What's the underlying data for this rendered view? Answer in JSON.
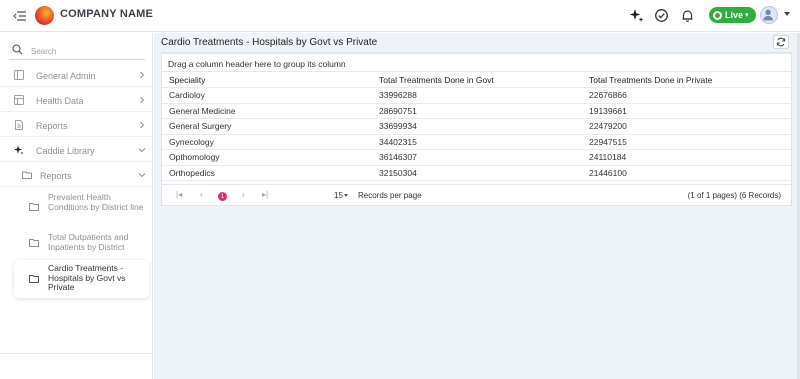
{
  "header": {
    "company_name": "COMPANY NAME",
    "live_label": "Live",
    "colors": {
      "live": "#2fae3b",
      "brand_primary": "#f2591f"
    },
    "icons": [
      "menu-collapse-icon",
      "sparkle-icon",
      "check-circle-icon",
      "bell-icon",
      "avatar-icon"
    ]
  },
  "sidebar": {
    "search_placeholder": "Search",
    "items": [
      {
        "label": "General Admin",
        "icon": "dashboard-icon"
      },
      {
        "label": "Health Data",
        "icon": "database-icon"
      },
      {
        "label": "Reports",
        "icon": "document-icon"
      },
      {
        "label": "Caddie Library",
        "icon": "sparkle-icon"
      }
    ],
    "reports_folder": "Reports",
    "sub_items": [
      {
        "label": "Prevalent Health Conditions by District line"
      },
      {
        "label": "Total Outpatients and Inpatients by District"
      },
      {
        "label": "Cardio Treatments - Hospitals by Govt vs Private"
      }
    ]
  },
  "main": {
    "title": "Cardio Treatments - Hospitals by Govt vs Private",
    "group_hint": "Drag a column header here to group its column",
    "columns": [
      "Speciality",
      "Total Treatments Done in Govt",
      "Total Treatments Done in Private"
    ],
    "rows": [
      [
        "Cardioloy",
        "33996288",
        "22676866"
      ],
      [
        "General Medicine",
        "28690751",
        "19139661"
      ],
      [
        "General Surgery",
        "33699934",
        "22479200"
      ],
      [
        "Gynecology",
        "34402315",
        "22947515"
      ],
      [
        "Opthomology",
        "36146307",
        "24110184"
      ],
      [
        "Orthopedics",
        "32150304",
        "21446100"
      ]
    ],
    "pager": {
      "current_page": "1",
      "page_size": "15",
      "records_per_page_label": "Records per page",
      "summary": "(1 of 1 pages) (6 Records)"
    }
  }
}
